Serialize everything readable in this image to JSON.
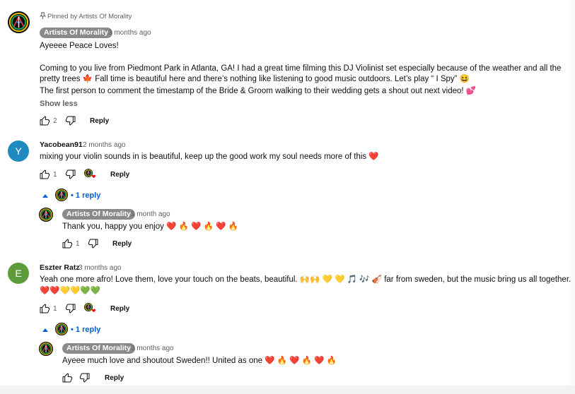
{
  "pinned": {
    "label": "Pinned by Artists Of Morality",
    "author": "Artists Of Morality",
    "time": "3 months ago",
    "line1": "Ayeeee Peace Loves!",
    "line2": "Coming to you live from Piedmont Park in Atlanta, GA! I had a great time filming this DJ Violinist set especially because of the weather and all the",
    "line3": "pretty trees 🍁 Fall time is beautiful here and there’s nothing like listening to good music outdoors. Let’s play “ I Spy” 😆",
    "line4": "The first person to comment the timestamp of the Bride & Groom walking to their wedding gets a shout out next video! 💕",
    "show_less": "Show less",
    "likes": "2",
    "reply": "Reply"
  },
  "comment1": {
    "avatar_letter": "Y",
    "avatar_color": "#1e8ac0",
    "author": "Yacobean91",
    "time": "2 months ago",
    "text": "mixing your violin sounds in is beautiful, keep up the good work my soul needs more of this ❤️",
    "likes": "1",
    "reply": "Reply",
    "replies_toggle": "1 reply",
    "reply_author": "Artists Of Morality",
    "reply_time": "1 month ago",
    "reply_text": "Thank you, happy you enjoy ❤️ 🔥 ❤️ 🔥 ❤️ 🔥",
    "reply_likes": "1",
    "reply_reply": "Reply"
  },
  "comment2": {
    "avatar_letter": "E",
    "avatar_color": "#5e9b3a",
    "author": "Eszter Ratz",
    "time": "3 months ago",
    "text1": "Yeah one more afro! Love them, love your touch on the beats, beautiful. 🙌🙌 💛 💛 🎵 🎶 🎻 far from sweden, but the music bring us all together.",
    "text2": "❤️❤️💛💛💚💚",
    "likes": "1",
    "reply": "Reply",
    "replies_toggle": "1 reply",
    "reply_author": "Artists Of Morality",
    "reply_time": "3 months ago",
    "reply_text": "Ayeee much love and shoutout Sweden!! United as one ❤️ 🔥 ❤️ 🔥 ❤️ 🔥",
    "reply_reply": "Reply"
  },
  "icons": {
    "like": "thumbs-up-icon",
    "dislike": "thumbs-down-icon",
    "pin": "pin-icon",
    "caret": "caret-up-icon",
    "heart": "creator-heart-icon"
  },
  "colors": {
    "link_blue": "#065fd4",
    "badge_grey": "#8a8a8a",
    "heart_red": "#ff0000"
  }
}
